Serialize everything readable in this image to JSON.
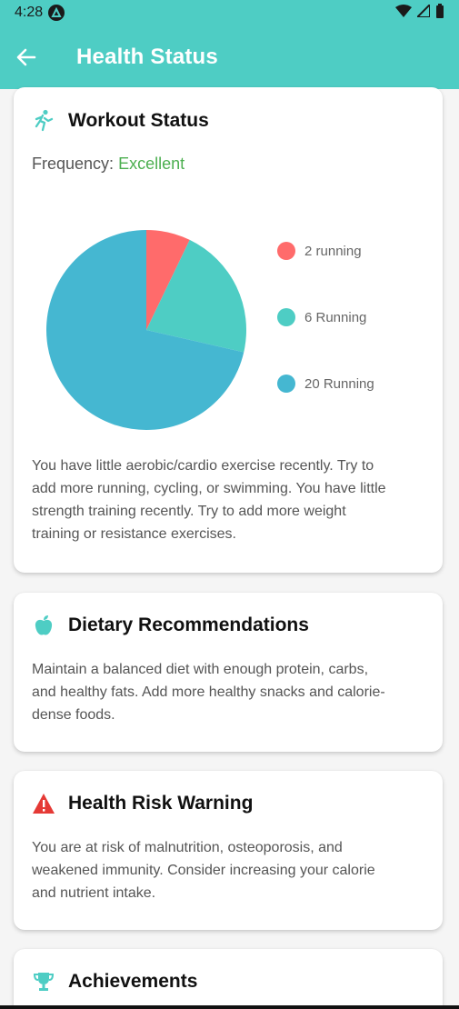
{
  "status_bar": {
    "time": "4:28"
  },
  "app_bar": {
    "title": "Health Status"
  },
  "workout": {
    "title": "Workout Status",
    "frequency_label": "Frequency:",
    "frequency_value": "Excellent",
    "description": "You have little aerobic/cardio exercise recently. Try to add more running, cycling, or swimming. You have little strength training recently. Try to add more weight training or resistance exercises."
  },
  "chart_data": {
    "type": "pie",
    "categories": [
      "2 running",
      "6 Running",
      "20 Running"
    ],
    "values": [
      2,
      6,
      20
    ],
    "colors": [
      "#ff6b6b",
      "#4ecdc4",
      "#45b7d1"
    ]
  },
  "diet": {
    "title": "Dietary Recommendations",
    "text": "Maintain a balanced diet with enough protein, carbs, and healthy fats. Add more healthy snacks and calorie-dense foods."
  },
  "risk": {
    "title": "Health Risk Warning",
    "text": "You are at risk of malnutrition, osteoporosis, and weakened immunity. Consider increasing your calorie and nutrient intake."
  },
  "achievements": {
    "title": "Achievements"
  },
  "colors": {
    "primary": "#4ecdc4",
    "success": "#4caf50",
    "warning": "#e53935"
  }
}
